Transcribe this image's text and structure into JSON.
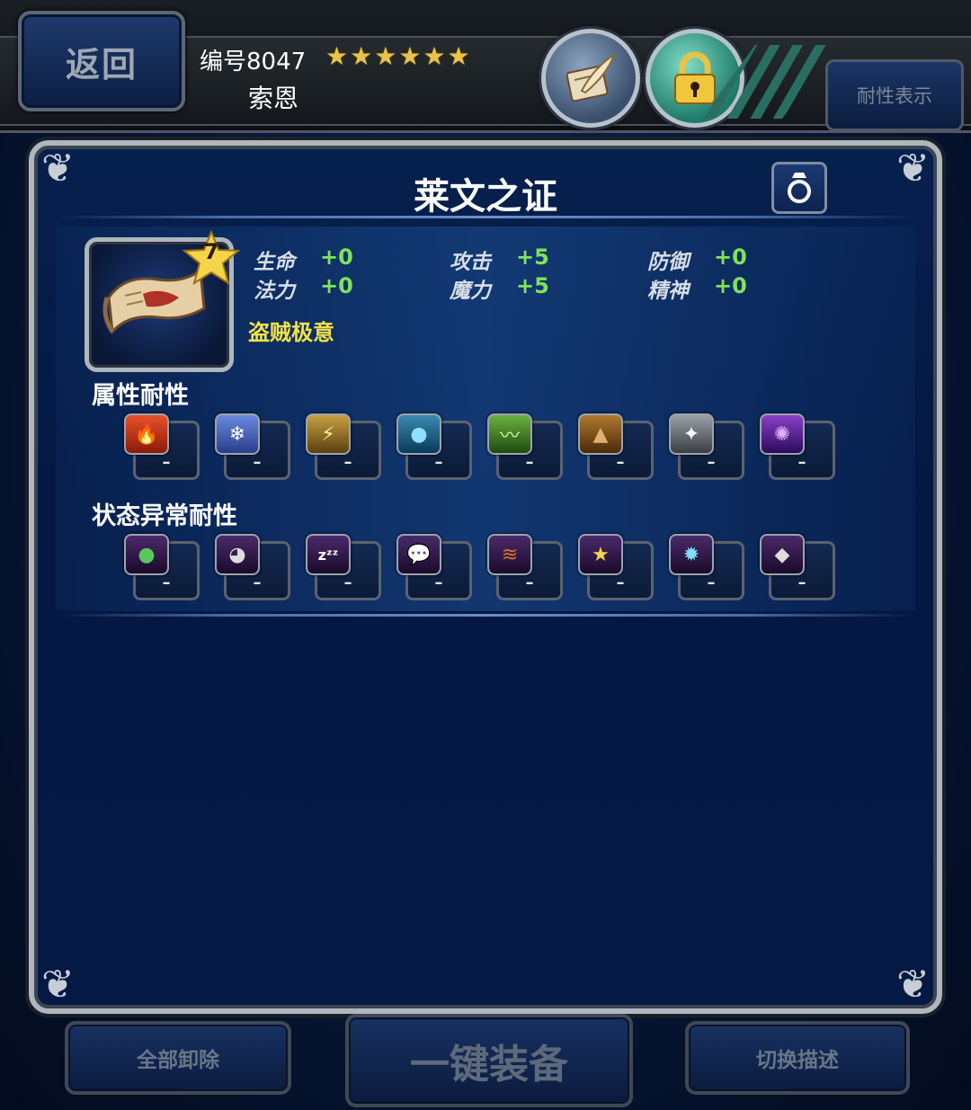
{
  "header": {
    "back_label": "返回",
    "char_id": "编号8047",
    "stars": [
      "★",
      "★",
      "★",
      "★",
      "★",
      "★"
    ],
    "char_name": "索恩",
    "resist_display_label": "耐性表示"
  },
  "equipment": {
    "name": "莱文之证",
    "level": "7",
    "stats": [
      {
        "label": "生命",
        "value": "+0"
      },
      {
        "label": "法力",
        "value": "+0"
      },
      {
        "label": "攻击",
        "value": "+5"
      },
      {
        "label": "魔力",
        "value": "+5"
      },
      {
        "label": "防御",
        "value": "+0"
      },
      {
        "label": "精神",
        "value": "+0"
      }
    ],
    "ability": "盗贼极意"
  },
  "element_resist": {
    "title": "属性耐性",
    "items": [
      {
        "icon": "fire-icon",
        "value": "–"
      },
      {
        "icon": "ice-icon",
        "value": "–"
      },
      {
        "icon": "lightning-icon",
        "value": "–"
      },
      {
        "icon": "water-icon",
        "value": "–"
      },
      {
        "icon": "wind-icon",
        "value": "–"
      },
      {
        "icon": "earth-icon",
        "value": "–"
      },
      {
        "icon": "holy-icon",
        "value": "–"
      },
      {
        "icon": "dark-icon",
        "value": "–"
      }
    ]
  },
  "status_resist": {
    "title": "状态异常耐性",
    "items": [
      {
        "icon": "poison-icon",
        "value": "–"
      },
      {
        "icon": "blind-icon",
        "value": "–"
      },
      {
        "icon": "sleep-icon",
        "value": "–"
      },
      {
        "icon": "silence-icon",
        "value": "–"
      },
      {
        "icon": "paralyze-icon",
        "value": "–"
      },
      {
        "icon": "confuse-icon",
        "value": "–"
      },
      {
        "icon": "disease-icon",
        "value": "–"
      },
      {
        "icon": "petrify-icon",
        "value": "–"
      }
    ]
  },
  "footer": {
    "unequip_all_label": "全部卸除",
    "auto_equip_label": "一键装备",
    "toggle_desc_label": "切换描述"
  }
}
